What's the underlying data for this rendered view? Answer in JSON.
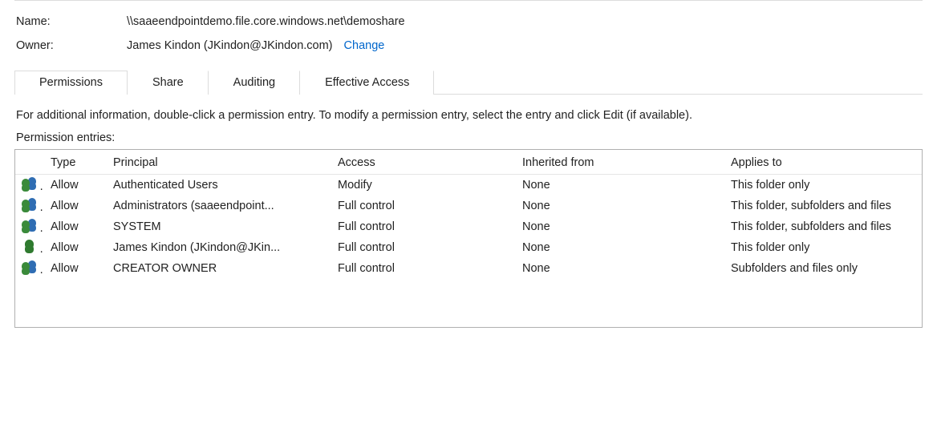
{
  "meta": {
    "name_label": "Name:",
    "name_value": "\\\\saaeendpointdemo.file.core.windows.net\\demoshare",
    "owner_label": "Owner:",
    "owner_value": "James Kindon (JKindon@JKindon.com)",
    "change_link": "Change"
  },
  "tabs": {
    "permissions": "Permissions",
    "share": "Share",
    "auditing": "Auditing",
    "effective": "Effective Access",
    "active": "permissions"
  },
  "intro": "For additional information, double-click a permission entry. To modify a permission entry, select the entry and click Edit (if available).",
  "entries_label": "Permission entries:",
  "columns": {
    "type": "Type",
    "principal": "Principal",
    "access": "Access",
    "inherited": "Inherited from",
    "applies": "Applies to"
  },
  "rows": [
    {
      "icon": "multi",
      "type": "Allow",
      "principal": "Authenticated Users",
      "access": "Modify",
      "inherited": "None",
      "applies": "This folder only"
    },
    {
      "icon": "multi",
      "type": "Allow",
      "principal": "Administrators (saaeendpoint...",
      "access": "Full control",
      "inherited": "None",
      "applies": "This folder, subfolders and files"
    },
    {
      "icon": "multi",
      "type": "Allow",
      "principal": "SYSTEM",
      "access": "Full control",
      "inherited": "None",
      "applies": "This folder, subfolders and files"
    },
    {
      "icon": "single",
      "type": "Allow",
      "principal": "James Kindon (JKindon@JKin...",
      "access": "Full control",
      "inherited": "None",
      "applies": "This folder only"
    },
    {
      "icon": "multi",
      "type": "Allow",
      "principal": "CREATOR OWNER",
      "access": "Full control",
      "inherited": "None",
      "applies": "Subfolders and files only"
    }
  ]
}
